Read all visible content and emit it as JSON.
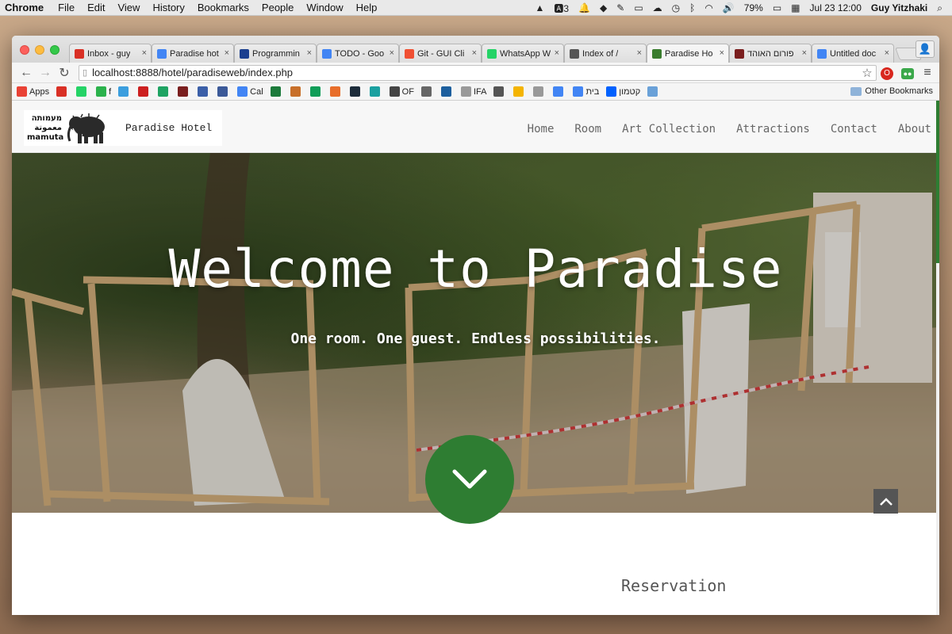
{
  "menubar": {
    "app": "Chrome",
    "items": [
      "File",
      "Edit",
      "View",
      "History",
      "Bookmarks",
      "People",
      "Window",
      "Help"
    ],
    "right": {
      "notification_count": "3",
      "battery": "79%",
      "datetime": "Jul 23  12:00",
      "user": "Guy Yitzhaki"
    }
  },
  "browser": {
    "tabs": [
      {
        "label": "Inbox - guy",
        "favicon": "gmail-icon",
        "color": "#d93025",
        "active": false
      },
      {
        "label": "Paradise hot",
        "favicon": "docs-icon",
        "color": "#4285f4",
        "active": false
      },
      {
        "label": "Programmin",
        "favicon": "firefox-icon",
        "color": "#1b3f8f",
        "active": false
      },
      {
        "label": "TODO - Goo",
        "favicon": "docs-icon",
        "color": "#4285f4",
        "active": false
      },
      {
        "label": "Git - GUI Cli",
        "favicon": "git-icon",
        "color": "#f05033",
        "active": false
      },
      {
        "label": "WhatsApp W",
        "favicon": "whatsapp-icon",
        "color": "#25d366",
        "active": false
      },
      {
        "label": "Index of /",
        "favicon": "github-icon",
        "color": "#555555",
        "active": false
      },
      {
        "label": "Paradise Ho",
        "favicon": "palm-icon",
        "color": "#3a7d2e",
        "active": true
      },
      {
        "label": "פורום האוהד",
        "favicon": "shield-icon",
        "color": "#7a1e1e",
        "active": false
      },
      {
        "label": "Untitled doc",
        "favicon": "docs-icon",
        "color": "#4285f4",
        "active": false
      }
    ],
    "url": "localhost:8888/hotel/paradiseweb/index.php",
    "bookmarks": [
      {
        "label": "Apps",
        "icon": "apps-grid-icon",
        "color": "#e94235"
      },
      {
        "label": "",
        "icon": "gmail-icon",
        "color": "#d93025"
      },
      {
        "label": "",
        "icon": "whatsapp-icon",
        "color": "#25d366"
      },
      {
        "label": "f",
        "icon": "feedly-icon",
        "color": "#2bb24c"
      },
      {
        "label": "",
        "icon": "star-icon",
        "color": "#3b9ede"
      },
      {
        "label": "",
        "icon": "y-icon",
        "color": "#cc1f1f"
      },
      {
        "label": "",
        "icon": "drive-icon",
        "color": "#1ea362"
      },
      {
        "label": "",
        "icon": "shield-icon",
        "color": "#7a1e1e"
      },
      {
        "label": "",
        "icon": "chart-icon",
        "color": "#3b5fa8"
      },
      {
        "label": "",
        "icon": "facebook-icon",
        "color": "#3b5998"
      },
      {
        "label": "Cal",
        "icon": "calendar-icon",
        "color": "#4285f4"
      },
      {
        "label": "",
        "icon": "bar-icon",
        "color": "#1b7a3a"
      },
      {
        "label": "",
        "icon": "tree-icon",
        "color": "#c8702a"
      },
      {
        "label": "",
        "icon": "sheets-icon",
        "color": "#0f9d58"
      },
      {
        "label": "",
        "icon": "trend-icon",
        "color": "#e86e2a"
      },
      {
        "label": "",
        "icon": "p-icon",
        "color": "#1c2b3a"
      },
      {
        "label": "",
        "icon": "loop-icon",
        "color": "#1aa0a0"
      },
      {
        "label": "OF",
        "icon": "of-icon",
        "color": "#444444"
      },
      {
        "label": "",
        "icon": "gear-icon",
        "color": "#666666"
      },
      {
        "label": "",
        "icon": "data-icon",
        "color": "#1d5f9e"
      },
      {
        "label": "IFA",
        "icon": "page-icon",
        "color": "#999999"
      },
      {
        "label": "",
        "icon": "person-icon",
        "color": "#555555"
      },
      {
        "label": "",
        "icon": "note-icon",
        "color": "#f4b400"
      },
      {
        "label": "",
        "icon": "page-icon",
        "color": "#999999"
      },
      {
        "label": "",
        "icon": "docs-icon",
        "color": "#4285f4"
      },
      {
        "label": "בית",
        "icon": "docs-icon",
        "color": "#4285f4"
      },
      {
        "label": "קטמון",
        "icon": "dropbox-icon",
        "color": "#0061fe"
      },
      {
        "label": "",
        "icon": "dots-icon",
        "color": "#6aa1d8"
      }
    ],
    "other_bookmarks": "Other Bookmarks"
  },
  "site": {
    "logo_text": [
      "מעמותה",
      "معموتة",
      "mamuta"
    ],
    "name": "Paradise Hotel",
    "nav": [
      "Home",
      "Room",
      "Art Collection",
      "Attractions",
      "Contact",
      "About"
    ],
    "hero_title": "Welcome to Paradise",
    "hero_subtitle": "One room. One guest. Endless possibilities.",
    "section_title": "Reservation",
    "accent": "#2e7d32"
  }
}
